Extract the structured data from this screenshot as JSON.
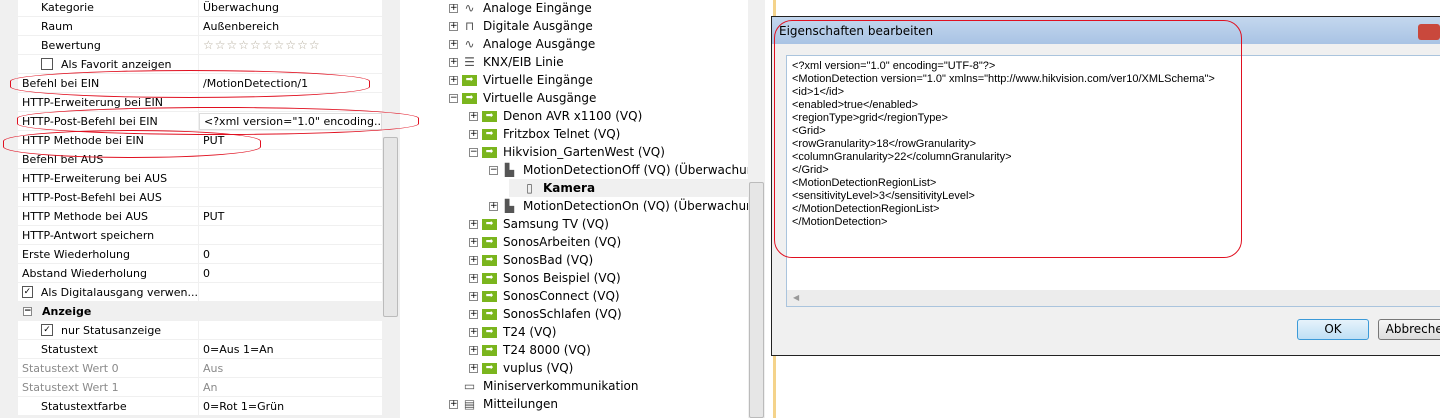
{
  "properties": [
    {
      "label": "Kategorie",
      "value": "Überwachung",
      "type": "ind"
    },
    {
      "label": "Raum",
      "value": "Außenbereich",
      "type": "ind"
    },
    {
      "label": "Bewertung",
      "value": "☆☆☆☆☆☆☆☆☆☆",
      "type": "stars"
    },
    {
      "label": "Als Favorit anzeigen",
      "value": "",
      "type": "check",
      "checked": false
    },
    {
      "label": "Befehl bei EIN",
      "value": "/MotionDetection/1"
    },
    {
      "label": "HTTP-Erweiterung bei EIN",
      "value": ""
    },
    {
      "label": "HTTP-Post-Befehl bei EIN",
      "value": "<?xml version=\"1.0\" encoding.....",
      "type": "edit"
    },
    {
      "label": "HTTP Methode bei EIN",
      "value": "PUT"
    },
    {
      "label": "Befehl bei AUS",
      "value": ""
    },
    {
      "label": "HTTP-Erweiterung bei AUS",
      "value": ""
    },
    {
      "label": "HTTP-Post-Befehl bei AUS",
      "value": ""
    },
    {
      "label": "HTTP Methode bei AUS",
      "value": "PUT"
    },
    {
      "label": "HTTP-Antwort speichern",
      "value": ""
    },
    {
      "label": "Erste Wiederholung",
      "value": "0"
    },
    {
      "label": "Abstand Wiederholung",
      "value": "0"
    },
    {
      "label": "Als Digitalausgang verwen...",
      "value": "",
      "type": "check0",
      "checked": true
    },
    {
      "label": "Anzeige",
      "value": "",
      "type": "cat"
    },
    {
      "label": "nur Statusanzeige",
      "value": "",
      "type": "check",
      "checked": true
    },
    {
      "label": "Statustext",
      "value": "0=Aus 1=An",
      "type": "ind"
    },
    {
      "label": "Statustext Wert 0",
      "value": "Aus",
      "type": "dis"
    },
    {
      "label": "Statustext Wert 1",
      "value": "An",
      "type": "dis"
    },
    {
      "label": "Statustextfarbe",
      "value": "0=Rot 1=Grün",
      "type": "ind"
    }
  ],
  "tree": [
    {
      "label": "Analoge Eingänge",
      "level": 0,
      "exp": "+",
      "icon": "analog-input"
    },
    {
      "label": "Digitale Ausgänge",
      "level": 0,
      "exp": "+",
      "icon": "digital-output"
    },
    {
      "label": "Analoge Ausgänge",
      "level": 0,
      "exp": "+",
      "icon": "analog-output"
    },
    {
      "label": "KNX/EIB Linie",
      "level": 0,
      "exp": "+",
      "icon": "knx"
    },
    {
      "label": "Virtuelle Eingänge",
      "level": 0,
      "exp": "+",
      "icon": "virtual"
    },
    {
      "label": "Virtuelle Ausgänge",
      "level": 0,
      "exp": "-",
      "icon": "virtual"
    },
    {
      "label": "Denon AVR x1100 (VQ)",
      "level": 1,
      "exp": "+",
      "icon": "virtual"
    },
    {
      "label": "Fritzbox Telnet (VQ)",
      "level": 1,
      "exp": "+",
      "icon": "virtual"
    },
    {
      "label": "Hikvision_GartenWest (VQ)",
      "level": 1,
      "exp": "-",
      "icon": "virtual"
    },
    {
      "label": "MotionDetectionOff (VQ) (Überwachung, Außenbereich)",
      "level": 2,
      "exp": "-",
      "icon": "command"
    },
    {
      "label": "Kamera",
      "level": 3,
      "exp": "",
      "icon": "document",
      "bold": true
    },
    {
      "label": "MotionDetectionOn (VQ) (Überwachung, Außenbereich)",
      "level": 2,
      "exp": "+",
      "icon": "command"
    },
    {
      "label": "Samsung TV (VQ)",
      "level": 1,
      "exp": "+",
      "icon": "virtual"
    },
    {
      "label": "SonosArbeiten (VQ)",
      "level": 1,
      "exp": "+",
      "icon": "virtual"
    },
    {
      "label": "SonosBad (VQ)",
      "level": 1,
      "exp": "+",
      "icon": "virtual"
    },
    {
      "label": "Sonos Beispiel (VQ)",
      "level": 1,
      "exp": "+",
      "icon": "virtual"
    },
    {
      "label": "SonosConnect (VQ)",
      "level": 1,
      "exp": "+",
      "icon": "virtual"
    },
    {
      "label": "SonosSchlafen (VQ)",
      "level": 1,
      "exp": "+",
      "icon": "virtual"
    },
    {
      "label": "T24 (VQ)",
      "level": 1,
      "exp": "+",
      "icon": "virtual"
    },
    {
      "label": "T24 8000 (VQ)",
      "level": 1,
      "exp": "+",
      "icon": "virtual"
    },
    {
      "label": "vuplus (VQ)",
      "level": 1,
      "exp": "+",
      "icon": "virtual"
    },
    {
      "label": "Miniserverkommunikation",
      "level": 0,
      "exp": "",
      "icon": "network"
    },
    {
      "label": "Mitteilungen",
      "level": 0,
      "exp": "+",
      "icon": "log"
    }
  ],
  "dialog": {
    "title": "Eigenschaften bearbeiten",
    "content": "<?xml version=\"1.0\" encoding=\"UTF-8\"?>\n<MotionDetection version=\"1.0\" xmlns=\"http://www.hikvision.com/ver10/XMLSchema\">\n<id>1</id>\n<enabled>true</enabled>\n<regionType>grid</regionType>\n<Grid>\n<rowGranularity>18</rowGranularity>\n<columnGranularity>22</columnGranularity>\n</Grid>\n<MotionDetectionRegionList>\n<sensitivityLevel>3</sensitivityLevel>\n</MotionDetectionRegionList>\n</MotionDetection>",
    "ok": "OK",
    "cancel": "Abbrechen"
  },
  "colors": {
    "accent": "#7ab51d",
    "annotation": "#e01020"
  }
}
